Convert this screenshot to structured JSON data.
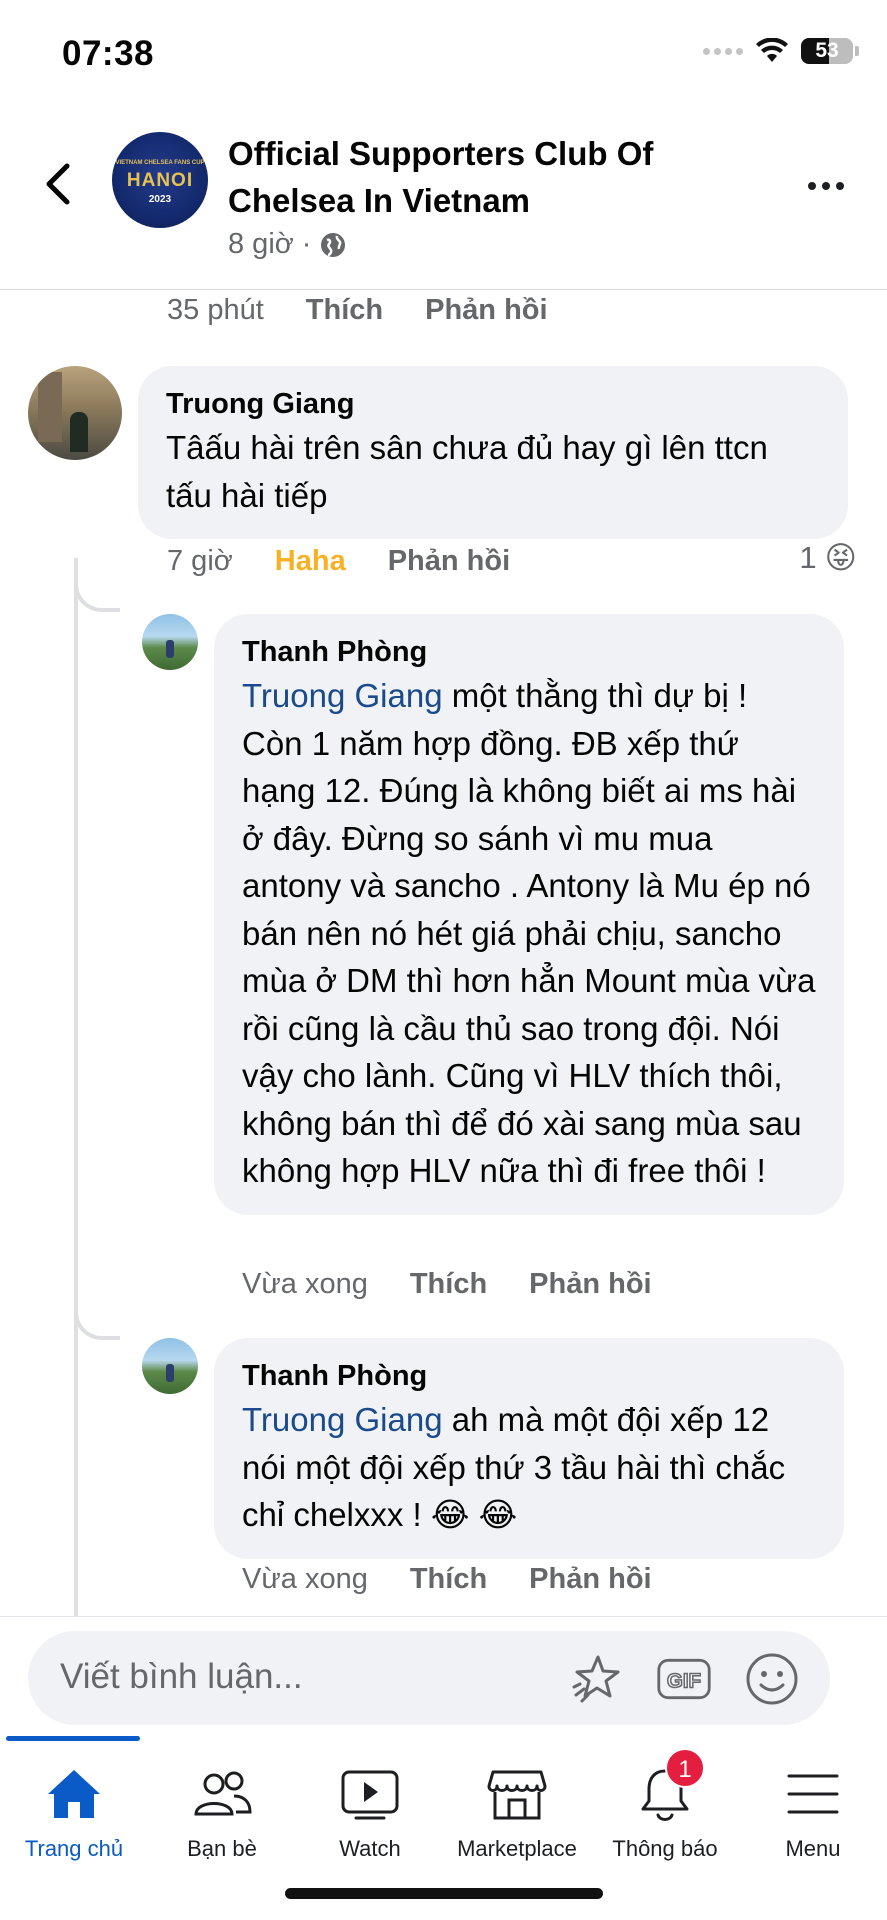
{
  "status_bar": {
    "time": "07:38",
    "battery": "53",
    "battery_level": 0.53
  },
  "header": {
    "title": "Official Supporters Club Of Chelsea In Vietnam",
    "time": "8 giờ",
    "separator": "·",
    "avatar_text": {
      "top": "VIETNAM CHELSEA FANS CUP",
      "main": "HANOI",
      "year": "2023"
    }
  },
  "prev_comment_actions": {
    "time": "35 phút",
    "like": "Thích",
    "reply": "Phản hồi"
  },
  "comments": [
    {
      "author": "Truong Giang",
      "text": "Tâấu hài trên sân chưa đủ hay gì lên ttcn tấu hài tiếp",
      "time": "7 giờ",
      "like": "Haha",
      "reply": "Phản hồi",
      "reaction_count": "1",
      "reaction_emoji": "😝"
    },
    {
      "author": "Thanh Phòng",
      "mention": "Truong Giang",
      "text": " một thằng thì dự bị ! Còn 1 năm hợp đồng. ĐB xếp thứ hạng 12. Đúng là không biết ai ms hài ở đây. Đừng so sánh vì mu mua antony và sancho . Antony là Mu ép nó bán nên nó hét giá phải chịu, sancho mùa ở DM thì hơn hẳn Mount mùa vừa rồi cũng là cầu thủ sao trong đội. Nói vậy cho lành. Cũng vì HLV thích thôi, không bán thì để đó xài sang mùa sau không hợp HLV nữa thì đi free thôi !",
      "time": "Vừa xong",
      "like": "Thích",
      "reply": "Phản hồi"
    },
    {
      "author": "Thanh Phòng",
      "mention": "Truong Giang",
      "text": " ah mà một đội xếp 12 nói một đội xếp thứ 3 tầu hài thì chắc chỉ chelxxx ! 😂 😂",
      "time": "Vừa xong",
      "like": "Thích",
      "reply": "Phản hồi"
    }
  ],
  "composer": {
    "placeholder": "Viết bình luận...",
    "gif_label": "GIF"
  },
  "tabs": [
    {
      "label": "Trang chủ",
      "icon": "home-icon"
    },
    {
      "label": "Bạn bè",
      "icon": "friends-icon"
    },
    {
      "label": "Watch",
      "icon": "watch-icon"
    },
    {
      "label": "Marketplace",
      "icon": "marketplace-icon"
    },
    {
      "label": "Thông báo",
      "icon": "bell-icon",
      "badge": "1"
    },
    {
      "label": "Menu",
      "icon": "menu-icon"
    }
  ],
  "colors": {
    "accent": "#0a5ac8",
    "haha": "#f7b125",
    "mention": "#1a4a8c",
    "badge": "#e41e3f",
    "bubble": "#f0f2f5"
  }
}
